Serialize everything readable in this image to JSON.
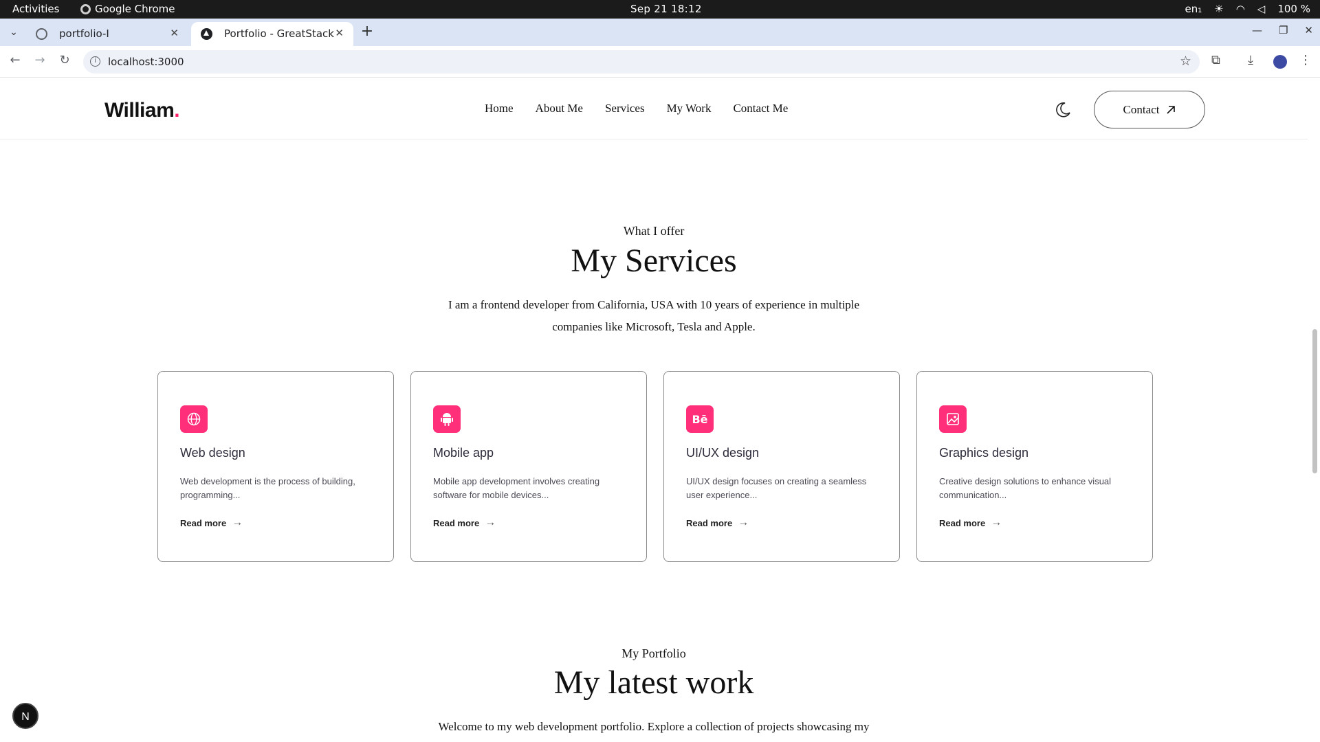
{
  "os": {
    "activities": "Activities",
    "app_name": "Google Chrome",
    "clock": "Sep 21  18:12",
    "lang": "en₁",
    "battery": "100 %"
  },
  "browser": {
    "tabs": [
      {
        "title": "portfolio-I",
        "active": false
      },
      {
        "title": "Portfolio - GreatStack",
        "active": true
      }
    ],
    "url": "localhost:3000"
  },
  "site": {
    "logo": "William",
    "logo_dot": ".",
    "nav": [
      "Home",
      "About Me",
      "Services",
      "My Work",
      "Contact Me"
    ],
    "contact_label": "Contact",
    "accent_color": "#ff2f7a"
  },
  "services": {
    "subtitle": "What I offer",
    "title": "My Services",
    "description": "I am a frontend developer from California, USA with 10 years of experience in multiple companies like Microsoft, Tesla and Apple.",
    "cards": [
      {
        "icon": "globe-icon",
        "title": "Web design",
        "desc": "Web development is the process of building, programming...",
        "more": "Read more"
      },
      {
        "icon": "android-icon",
        "title": "Mobile app",
        "desc": "Mobile app development involves creating software for mobile devices...",
        "more": "Read more"
      },
      {
        "icon": "behance-icon",
        "icon_text": "Bē",
        "title": "UI/UX design",
        "desc": "UI/UX design focuses on creating a seamless user experience...",
        "more": "Read more"
      },
      {
        "icon": "image-icon",
        "title": "Graphics design",
        "desc": "Creative design solutions to enhance visual communication...",
        "more": "Read more"
      }
    ]
  },
  "work": {
    "subtitle": "My Portfolio",
    "title": "My latest work",
    "description": "Welcome to my web development portfolio. Explore a collection of projects showcasing my"
  },
  "next_badge": "N"
}
